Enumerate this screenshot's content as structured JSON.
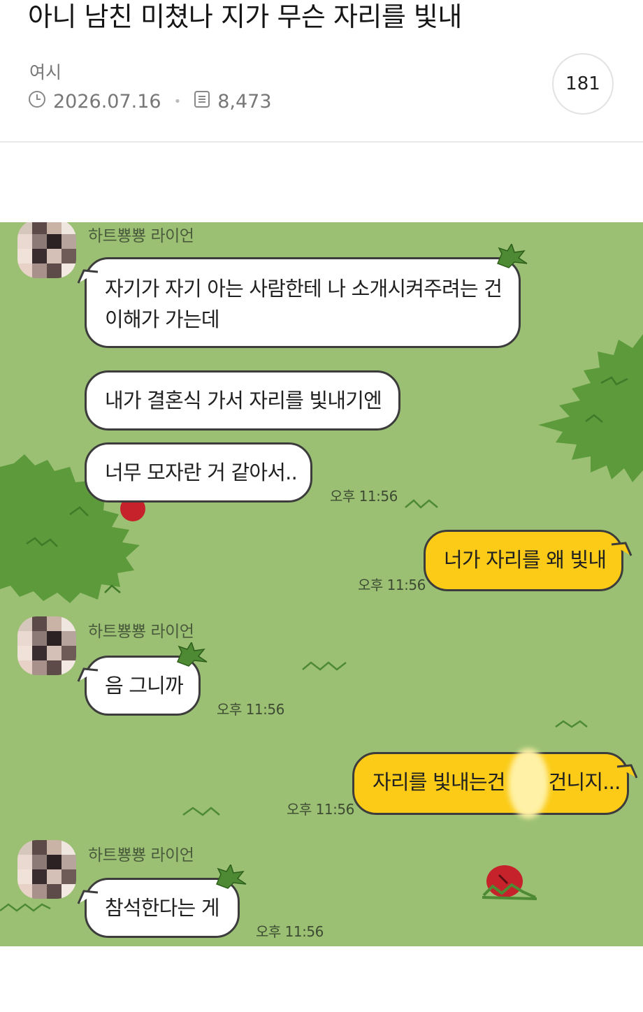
{
  "post": {
    "title": "아니 남친 미쳤나 지가 무슨 자리를 빛내",
    "author": "여시",
    "date": "2026.07.16",
    "views": "8,473",
    "comment_count": "181",
    "icons": {
      "date": "clock-icon",
      "views": "document-icon"
    }
  },
  "chat": {
    "background_color": "#9bc073",
    "bubble_in_color": "#ffffff",
    "bubble_out_color": "#fbcb17",
    "messages": [
      {
        "sender": "하트뿅뿅 라이언",
        "lines": [
          "자기가 자기 아는 사람한테 나 소개시켜주려는 건",
          "이해가 가는데"
        ]
      },
      {
        "lines": [
          "내가 결혼식 가서 자리를 빛내기엔"
        ]
      },
      {
        "lines": [
          "너무 모자란 거 같아서.."
        ],
        "time": "오후 11:56"
      },
      {
        "lines": [
          "너가 자리를 왜 빛내"
        ],
        "time": "오후 11:56"
      },
      {
        "sender": "하트뿅뿅 라이언",
        "lines": [
          "음 그니까"
        ],
        "time": "오후 11:56"
      },
      {
        "lines": [
          "자리를 빛내는건",
          "건니지..."
        ],
        "time": "오후 11:56"
      },
      {
        "sender": "하트뿅뿅 라이언",
        "lines": [
          "참석한다는 게"
        ],
        "time": "오후 11:56"
      }
    ]
  }
}
